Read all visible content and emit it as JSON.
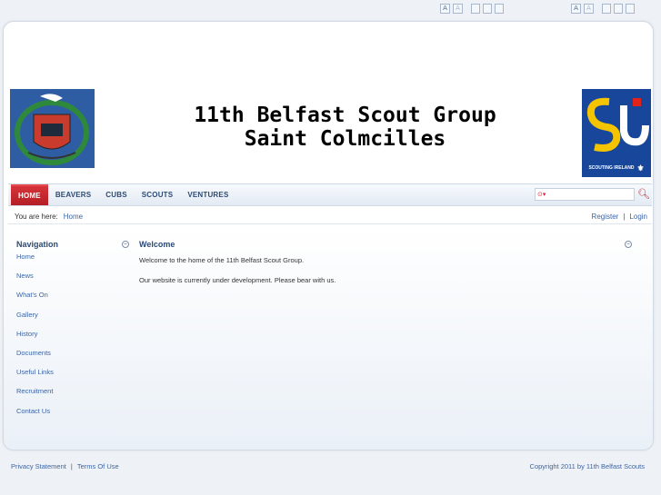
{
  "controls": {
    "left_group": [
      "A",
      "A"
    ],
    "right_group": [
      "A",
      "A"
    ]
  },
  "banner": {
    "title_line1": "11th Belfast Scout Group",
    "title_line2": "Saint Colmcilles",
    "logo_right_text": "SCOUTING IRELAND"
  },
  "nav": {
    "items": [
      {
        "label": "HOME"
      },
      {
        "label": "BEAVERS"
      },
      {
        "label": "CUBS"
      },
      {
        "label": "SCOUTS"
      },
      {
        "label": "VENTURES"
      }
    ],
    "search_placeholder": ""
  },
  "breadcrumb": {
    "prefix": "You are here:",
    "current": "Home",
    "register": "Register",
    "sep": "|",
    "login": "Login"
  },
  "sidebar": {
    "title": "Navigation",
    "items": [
      {
        "label": "Home"
      },
      {
        "label": "News"
      },
      {
        "label": "What's On"
      },
      {
        "label": "Gallery"
      },
      {
        "label": "History"
      },
      {
        "label": "Documents"
      },
      {
        "label": "Useful Links"
      },
      {
        "label": "Recruitment"
      },
      {
        "label": "Contact Us"
      }
    ]
  },
  "content": {
    "title": "Welcome",
    "para1": "Welcome to the home of the 11th Belfast Scout Group.",
    "para2": "Our website is currently under development. Please bear with us."
  },
  "footer": {
    "privacy": "Privacy Statement",
    "sep": "|",
    "terms": "Terms Of Use",
    "copyright": "Copyright 2011 by 11th Belfast Scouts"
  },
  "colors": {
    "accent": "#c0262c",
    "link": "#3b64a3",
    "heading": "#2c4a73"
  }
}
